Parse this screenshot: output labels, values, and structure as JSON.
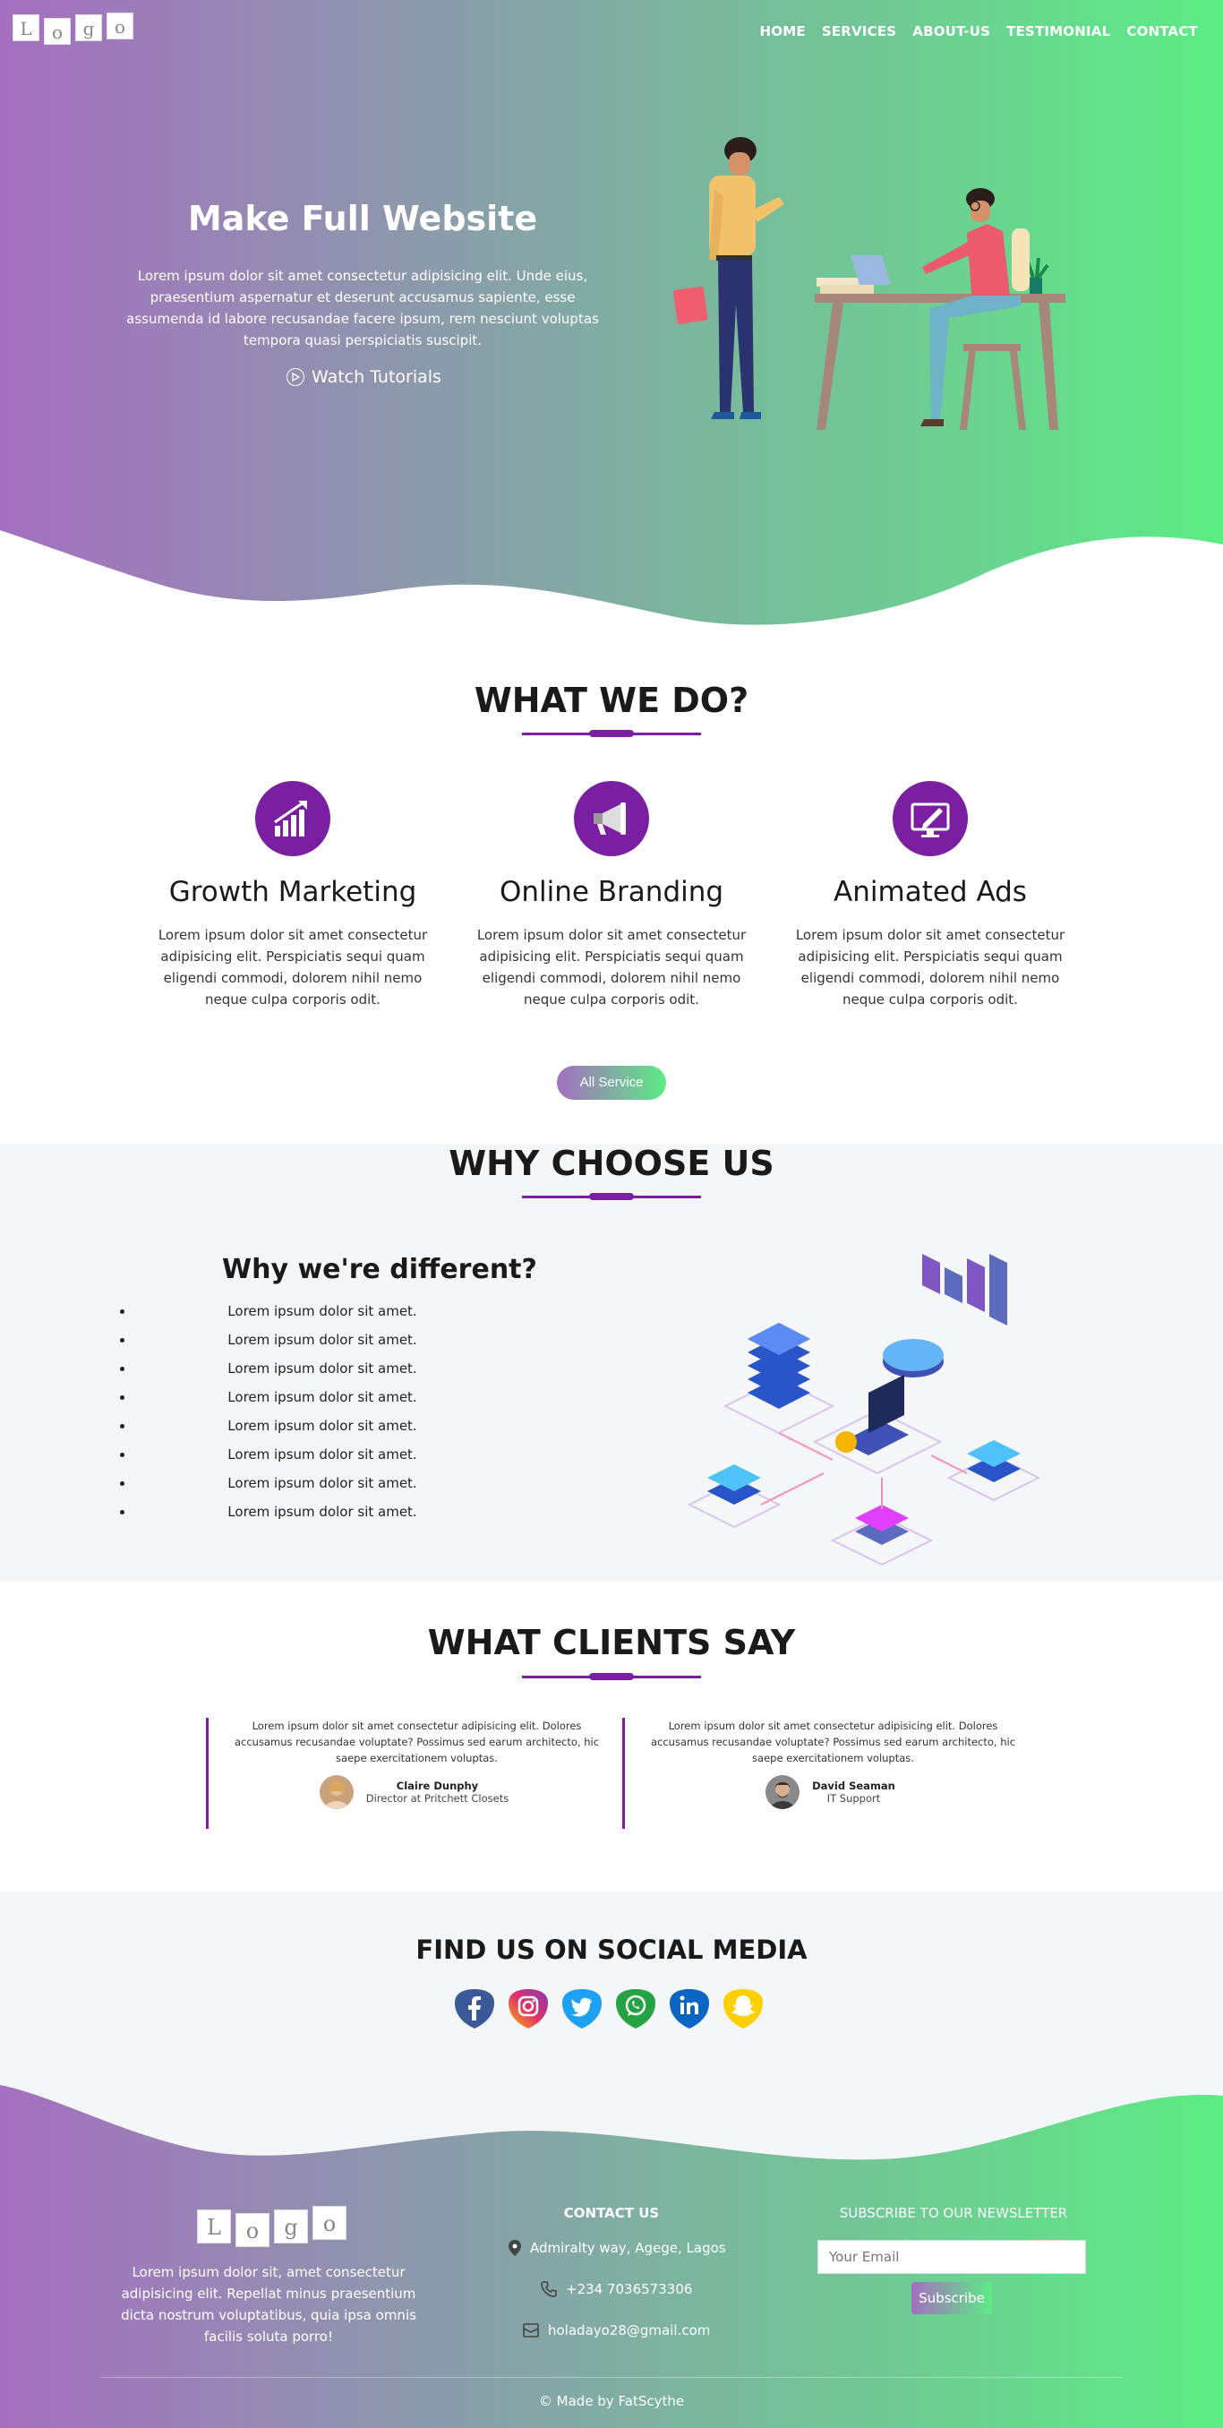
{
  "brand": {
    "logo_letters": [
      "L",
      "o",
      "g",
      "o"
    ],
    "gradient_start": "#a56fc0",
    "gradient_end": "#5cec84",
    "accent": "#7b1fa2"
  },
  "nav": {
    "items": [
      "HOME",
      "SERVICES",
      "ABOUT-US",
      "TESTIMONIAL",
      "CONTACT"
    ]
  },
  "hero": {
    "title": "Make Full Website",
    "text": "Lorem ipsum dolor sit amet consectetur adipisicing elit. Unde eius, praesentium aspernatur et deserunt accusamus sapiente, esse assumenda id labore recusandae facere ipsum, rem nesciunt voluptas tempora quasi perspiciatis suscipit.",
    "cta": "Watch Tutorials",
    "cta_icon": "play-circle-icon"
  },
  "services": {
    "title": "WHAT WE DO?",
    "items": [
      {
        "title": "Growth Marketing",
        "icon": "chart-growth-icon",
        "text": "Lorem ipsum dolor sit amet consectetur adipisicing elit. Perspiciatis sequi quam eligendi commodi, dolorem nihil nemo neque culpa corporis odit."
      },
      {
        "title": "Online Branding",
        "icon": "megaphone-icon",
        "text": "Lorem ipsum dolor sit amet consectetur adipisicing elit. Perspiciatis sequi quam eligendi commodi, dolorem nihil nemo neque culpa corporis odit."
      },
      {
        "title": "Animated Ads",
        "icon": "monitor-edit-icon",
        "text": "Lorem ipsum dolor sit amet consectetur adipisicing elit. Perspiciatis sequi quam eligendi commodi, dolorem nihil nemo neque culpa corporis odit."
      }
    ],
    "button": "All Service"
  },
  "why": {
    "title": "WHY CHOOSE US",
    "subtitle": "Why we're different?",
    "items": [
      "Lorem ipsum dolor sit amet.",
      "Lorem ipsum dolor sit amet.",
      "Lorem ipsum dolor sit amet.",
      "Lorem ipsum dolor sit amet.",
      "Lorem ipsum dolor sit amet.",
      "Lorem ipsum dolor sit amet.",
      "Lorem ipsum dolor sit amet.",
      "Lorem ipsum dolor sit amet."
    ]
  },
  "testimonials": {
    "title": "WHAT CLIENTS SAY",
    "items": [
      {
        "text": "Lorem ipsum dolor sit amet consectetur adipisicing elit. Dolores accusamus recusandae voluptate? Possimus sed earum architecto, hic saepe exercitationem voluptas.",
        "name": "Claire Dunphy",
        "role": "Director at Pritchett Closets"
      },
      {
        "text": "Lorem ipsum dolor sit amet consectetur adipisicing elit. Dolores accusamus recusandae voluptate? Possimus sed earum architecto, hic saepe exercitationem voluptas.",
        "name": "David Seaman",
        "role": "IT Support"
      }
    ]
  },
  "social": {
    "title": "FIND US ON SOCIAL MEDIA",
    "icons": [
      {
        "name": "facebook-icon",
        "glyph": "f",
        "color": "#3b5998"
      },
      {
        "name": "instagram-icon",
        "glyph": "◎",
        "color": "#c13584"
      },
      {
        "name": "twitter-icon",
        "glyph": "t",
        "color": "#1da1f2"
      },
      {
        "name": "whatsapp-icon",
        "glyph": "✆",
        "color": "#25a244"
      },
      {
        "name": "linkedin-icon",
        "glyph": "in",
        "color": "#0a66c2"
      },
      {
        "name": "snapchat-icon",
        "glyph": "☺",
        "color": "#ffd000"
      }
    ]
  },
  "footer": {
    "about": "Lorem ipsum dolor sit, amet consectetur adipisicing elit. Repellat minus praesentium dicta nostrum voluptatibus, quia ipsa omnis facilis soluta porro!",
    "contact_title": "CONTACT US",
    "address": "Admiralty way, Agege, Lagos",
    "phone": "+234 7036573306",
    "email": "holadayo28@gmail.com",
    "newsletter_title": "SUBSCRIBE TO OUR NEWSLETTER",
    "email_placeholder": "Your Email",
    "subscribe": "Subscribe",
    "copyright": "© Made by FatScythe"
  }
}
